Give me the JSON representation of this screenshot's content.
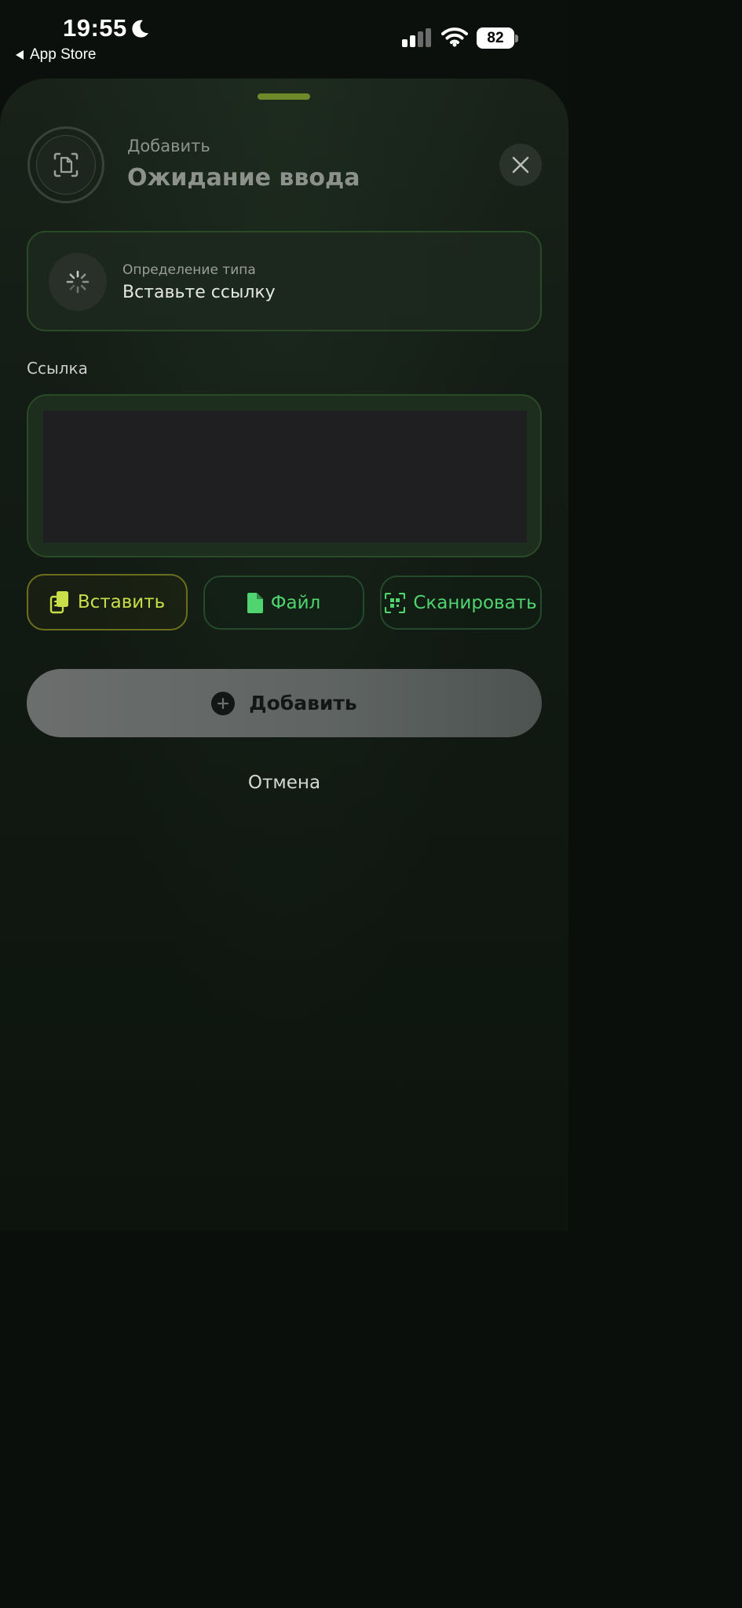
{
  "status_bar": {
    "time": "19:55",
    "back_app": "App Store",
    "battery": "82"
  },
  "header": {
    "subtitle": "Добавить",
    "title": "Ожидание ввода"
  },
  "type_card": {
    "label": "Определение типа",
    "value": "Вставьте ссылку"
  },
  "link": {
    "label": "Ссылка",
    "value": "",
    "placeholder": ""
  },
  "actions": {
    "paste": "Вставить",
    "file": "Файл",
    "scan": "Сканировать"
  },
  "add_button": "Добавить",
  "cancel": "Отмена",
  "colors": {
    "accent_lime": "#c9df4a",
    "accent_green": "#4fd46f",
    "grabber": "#6f8a2a"
  }
}
